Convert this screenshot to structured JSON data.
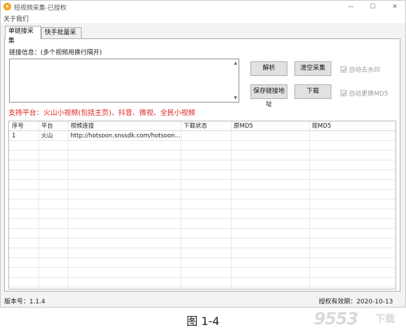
{
  "window": {
    "title": "短视频采集-已授权",
    "minimize": "—",
    "maximize": "☐",
    "close": "✕"
  },
  "menu": {
    "about": "关于我们"
  },
  "tabs": [
    {
      "label": "单链接采集",
      "active": true
    },
    {
      "label": "快手批量采集",
      "active": false
    }
  ],
  "link_input": {
    "label": "链接信息：(多个视频用换行隔开)",
    "value": ""
  },
  "buttons": {
    "parse": "解析",
    "clear": "清空采集",
    "save": "保存链接地址",
    "download": "下载"
  },
  "options": {
    "auto_watermark": {
      "label": "自动去水印",
      "checked": true,
      "enabled": false
    },
    "auto_md5": {
      "label": "自动更换MD5",
      "checked": true,
      "enabled": false
    }
  },
  "platform_note": "支持平台：火山小视频(包括主页)、抖音、微视、全民小视频",
  "table": {
    "columns": [
      "序号",
      "平台",
      "视频连接",
      "下载状态",
      "原MD5",
      "现MD5"
    ],
    "rows": [
      [
        "1",
        "火山",
        "http://hotsoon.snssdk.com/hotsoon...",
        "",
        "",
        ""
      ]
    ]
  },
  "status": {
    "version": "版本号：1.1.4",
    "license": "授权有效期：2020-10-13"
  },
  "caption": "图 1-4",
  "watermark": "9553下载",
  "colors": {
    "platform_note": "#e02020",
    "window_bg": "#f3f3f3",
    "button_bg": "#e1e1e1"
  }
}
